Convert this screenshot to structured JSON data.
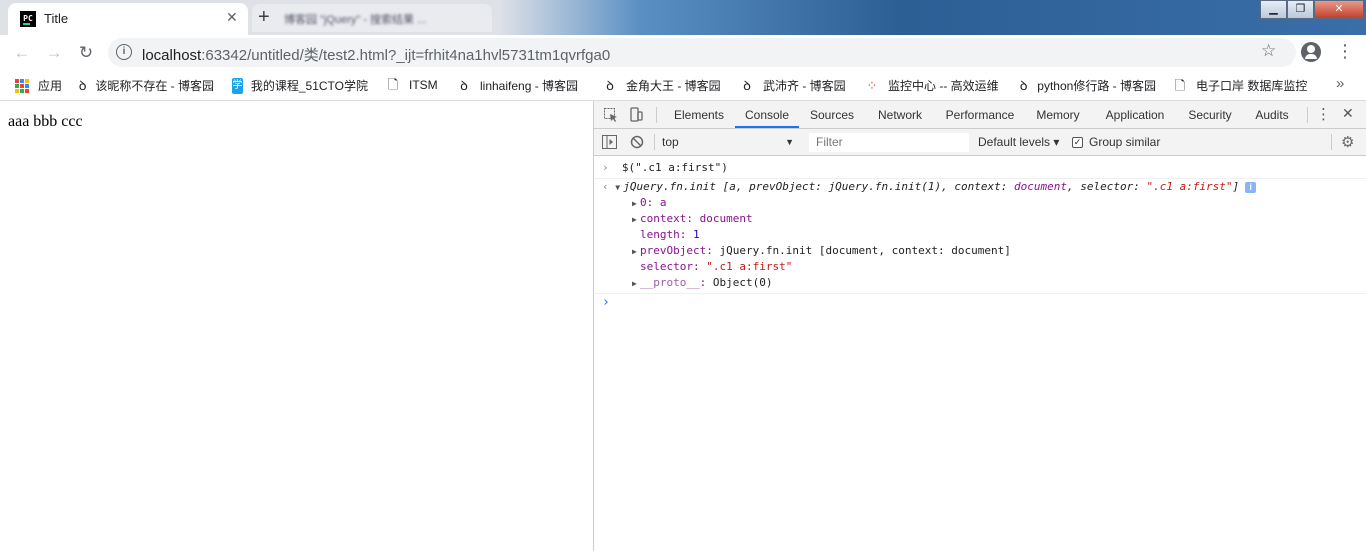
{
  "browser": {
    "tab_title": "Title",
    "tab_favicon": "PC",
    "tab_close": "✕",
    "second_tab_text": "博客园 \"jQuery\" - 搜索结果 ...",
    "new_tab": "+",
    "window": {
      "minimize": "▁",
      "maximize": "❐",
      "close": "✕"
    },
    "url_host": "localhost",
    "url_rest": ":63342/untitled/类/test2.html?_ijt=frhit4na1hvl5731tm1qvrfga0",
    "icons": {
      "back": "back-arrow-icon",
      "forward": "forward-arrow-icon",
      "reload": "reload-icon",
      "info": "info-icon",
      "star": "star-icon",
      "profile": "profile-icon",
      "menu": "kebab-menu-icon"
    }
  },
  "bookmarks": [
    {
      "label": "应用",
      "icon": "apps-icon"
    },
    {
      "label": "该昵称不存在 - 博客园",
      "icon": "cnblogs-icon"
    },
    {
      "label": "我的课程_51CTO学院",
      "icon": "51cto-icon"
    },
    {
      "label": "ITSM",
      "icon": "page-icon"
    },
    {
      "label": "linhaifeng - 博客园",
      "icon": "cnblogs-icon"
    },
    {
      "label": "金角大王 - 博客园",
      "icon": "cnblogs-icon"
    },
    {
      "label": "武沛齐 - 博客园",
      "icon": "cnblogs-icon"
    },
    {
      "label": "监控中心 -- 高效运维",
      "icon": "spinner-icon"
    },
    {
      "label": "python修行路 - 博客园",
      "icon": "cnblogs-icon"
    },
    {
      "label": "电子口岸 数据库监控",
      "icon": "page-icon"
    }
  ],
  "bookmarks_more": "»",
  "page": {
    "text": "aaa bbb ccc"
  },
  "devtools": {
    "tabs": [
      "Elements",
      "Console",
      "Sources",
      "Network",
      "Performance",
      "Memory",
      "Application",
      "Security",
      "Audits"
    ],
    "active_tab": "Console",
    "context": "top",
    "filter_placeholder": "Filter",
    "levels": "Default levels ▾",
    "group_similar": "Group similar",
    "console": {
      "input": "$(\".c1 a:first\")",
      "result_summary_prefix": "jQuery.fn.init [a, prevObject: jQuery.fn.init(1), context: ",
      "result_context": "document",
      "result_mid": ", selector: ",
      "result_selector": "\".c1 a:first\"",
      "result_end": "]",
      "props": [
        {
          "key": "0",
          "value": "a",
          "expandable": true
        },
        {
          "key": "context",
          "value": "document",
          "expandable": true
        },
        {
          "key": "length",
          "value": "1",
          "expandable": false
        },
        {
          "key": "prevObject",
          "value": "jQuery.fn.init [document, context: document]",
          "expandable": true
        },
        {
          "key": "selector",
          "value": "\".c1 a:first\"",
          "expandable": false
        },
        {
          "key": "__proto__",
          "value": "Object(0)",
          "expandable": true
        }
      ]
    }
  }
}
